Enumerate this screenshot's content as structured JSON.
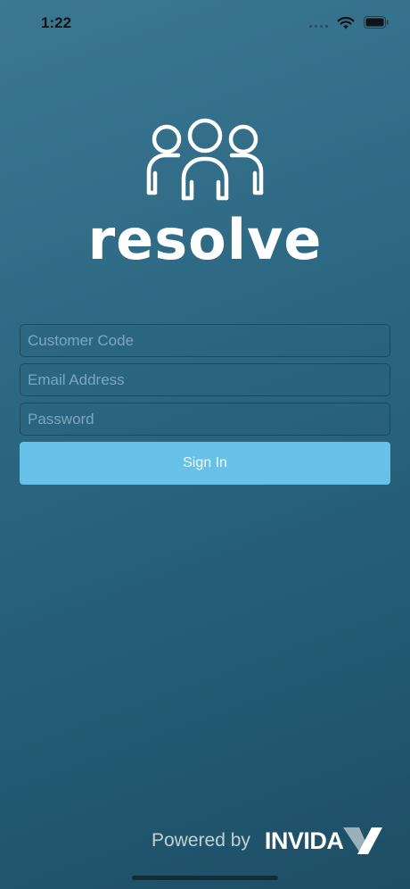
{
  "status_bar": {
    "time": "1:22"
  },
  "logo": {
    "text": "resolve",
    "icon": "people-group-icon"
  },
  "form": {
    "customer_code": {
      "placeholder": "Customer Code",
      "value": ""
    },
    "email": {
      "placeholder": "Email Address",
      "value": ""
    },
    "password": {
      "placeholder": "Password",
      "value": ""
    },
    "sign_in_label": "Sign In"
  },
  "footer": {
    "powered_by": "Powered by",
    "brand": "INVIDA"
  },
  "colors": {
    "button": "#67c1e8",
    "background_top": "#3b7892",
    "background_bottom": "#1d4f66"
  }
}
